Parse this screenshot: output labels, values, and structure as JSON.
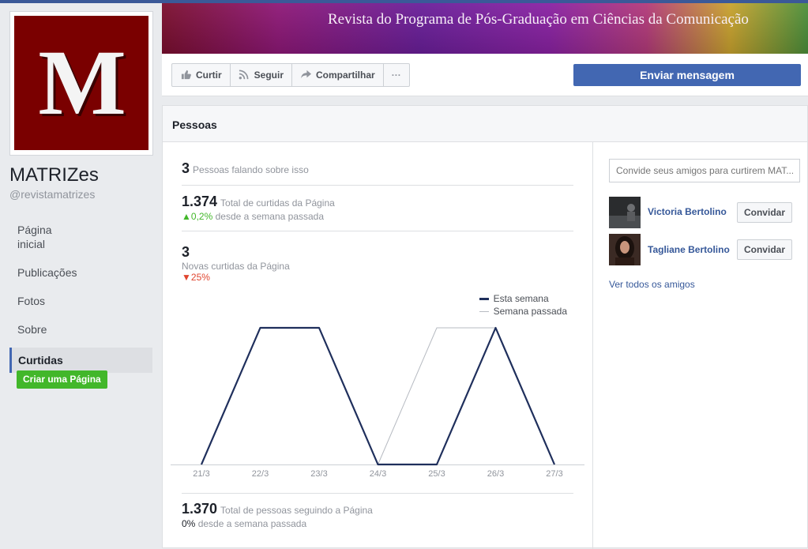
{
  "page": {
    "logo_letter": "M",
    "name": "MATRIZes",
    "handle": "@revistamatrizes",
    "cover_text": "Revista do Programa de Pós-Graduação em Ciências da Comunicação"
  },
  "sidebar": {
    "items": [
      {
        "label": "Página\ninicial"
      },
      {
        "label": "Publicações"
      },
      {
        "label": "Fotos"
      },
      {
        "label": "Sobre"
      },
      {
        "label": "Curtidas"
      }
    ],
    "active_index": 4,
    "create_button": "Criar uma Página"
  },
  "actions": {
    "like": "Curtir",
    "follow": "Seguir",
    "share": "Compartilhar",
    "more": "···",
    "send_message": "Enviar mensagem"
  },
  "section": {
    "title": "Pessoas"
  },
  "stats": {
    "talking": {
      "value": "3",
      "label": "Pessoas falando sobre isso"
    },
    "total_likes": {
      "value": "1.374",
      "label": "Total de curtidas da Página",
      "trend": "0,2%",
      "trend_label": "desde a semana passada"
    },
    "new_likes": {
      "value": "3",
      "label": "Novas curtidas da Página",
      "trend": "25%"
    },
    "followers": {
      "value": "1.370",
      "label": "Total de pessoas seguindo a Página",
      "trend": "0%",
      "trend_label": "desde a semana passada"
    }
  },
  "chart_data": {
    "type": "line",
    "categories": [
      "21/3",
      "22/3",
      "23/3",
      "24/3",
      "25/3",
      "26/3",
      "27/3"
    ],
    "series": [
      {
        "name": "Esta semana",
        "values": [
          0,
          1,
          1,
          0,
          0,
          1,
          0
        ],
        "color": "#1f2f5c"
      },
      {
        "name": "Semana passada",
        "values": [
          0,
          1,
          1,
          0,
          1,
          1,
          0
        ],
        "color": "#b7bbc2"
      }
    ],
    "ylim": [
      0,
      1
    ],
    "grid": false,
    "legend": "top-right"
  },
  "invite": {
    "placeholder": "Convide seus amigos para curtirem MAT...",
    "friends": [
      {
        "name": "Victoria Bertolino",
        "button": "Convidar"
      },
      {
        "name": "Tagliane Bertolino",
        "button": "Convidar"
      }
    ],
    "see_all": "Ver todos os amigos"
  },
  "colors": {
    "accent": "#4267b2",
    "page_bg": "#e9ebee",
    "positive": "#42b72a",
    "negative": "#e0452f",
    "logo_bg": "#7a0000"
  }
}
